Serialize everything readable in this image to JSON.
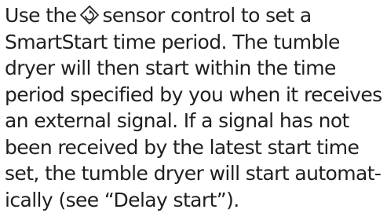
{
  "paragraph": {
    "line1_before": "Use the",
    "icon_name": "delay-start-sensor-icon",
    "line1_after": "sensor control to set a",
    "line2": "SmartStart time period. The tumble",
    "line3": "dryer will then start within the time",
    "line4": "period specified by you when it receives",
    "line5": "an external signal. If a signal has not",
    "line6": "been received by the latest start time",
    "line7": "set, the tumble dryer will start automat-",
    "line8": "ically (see “Delay start”)."
  },
  "colors": {
    "text": "#1f1f1f",
    "background": "#ffffff"
  }
}
